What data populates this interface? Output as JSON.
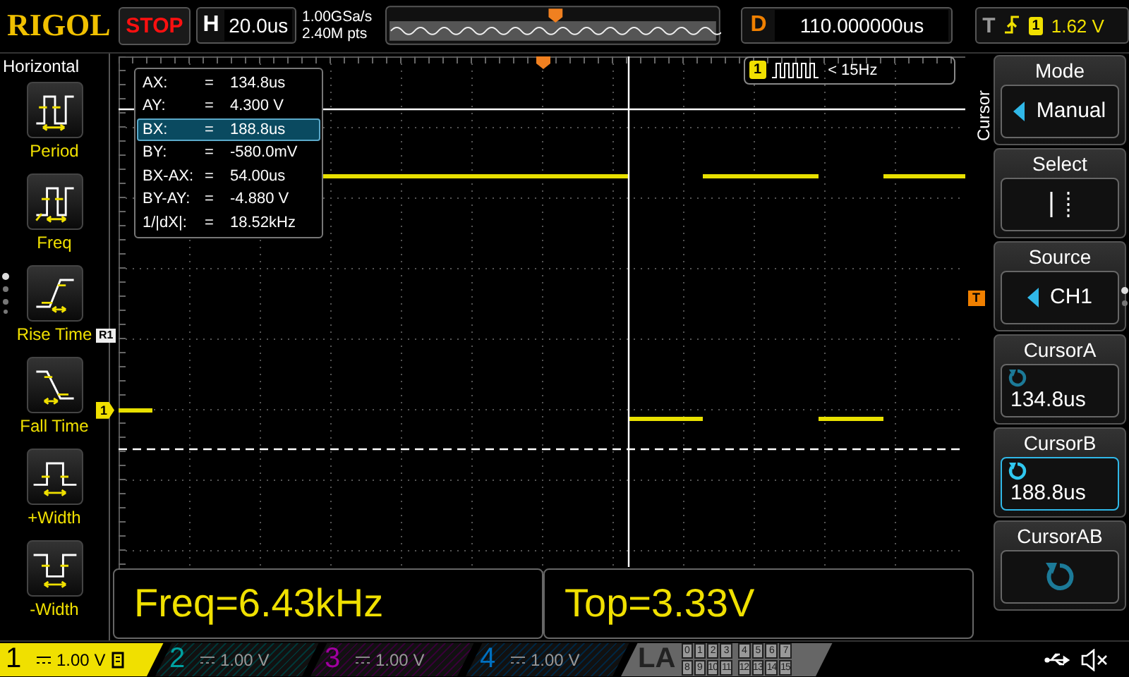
{
  "top_bar": {
    "logo": "RIGOL",
    "run_state": "STOP",
    "horizontal": {
      "label": "H",
      "value": "20.0us"
    },
    "sample_rate": "1.00GSa/s",
    "memory_depth": "2.40M pts",
    "delay": {
      "label": "D",
      "value": "110.000000us"
    },
    "trigger": {
      "label": "T",
      "channel": "1",
      "level": "1.62 V"
    }
  },
  "left_menu": {
    "title": "Horizontal",
    "items": [
      {
        "kind": "period",
        "label": "Period"
      },
      {
        "kind": "freq",
        "label": "Freq"
      },
      {
        "kind": "rise",
        "label": "Rise Time"
      },
      {
        "kind": "fall",
        "label": "Fall Time"
      },
      {
        "kind": "pwidth",
        "label": "+Width"
      },
      {
        "kind": "nwidth",
        "label": "-Width"
      }
    ]
  },
  "screen": {
    "reference_marker": "R1",
    "channel_marker": "1",
    "trigger_level_marker": "T",
    "cursor_readout": [
      {
        "label": "AX:",
        "sign": "=",
        "value": "134.8us",
        "selected": false
      },
      {
        "label": "AY:",
        "sign": "=",
        "value": "4.300 V",
        "selected": false
      },
      {
        "label": "BX:",
        "sign": "=",
        "value": "188.8us",
        "selected": true
      },
      {
        "label": "BY:",
        "sign": "=",
        "value": "-580.0mV",
        "selected": false
      },
      {
        "label": "BX-AX:",
        "sign": "=",
        "value": "54.00us",
        "selected": false
      },
      {
        "label": "BY-AY:",
        "sign": "=",
        "value": "-4.880 V",
        "selected": false
      },
      {
        "label": "1/|dX|:",
        "sign": "=",
        "value": "18.52kHz",
        "selected": false
      }
    ],
    "trigger_counter": {
      "channel": "1",
      "value": "< 15Hz"
    },
    "measurements": [
      {
        "text": "Freq=6.43kHz"
      },
      {
        "text": "Top=3.33V"
      }
    ]
  },
  "side_menu": {
    "title": "Cursor",
    "items": [
      {
        "kind": "select",
        "label": "Mode",
        "value": "Manual",
        "selected": false
      },
      {
        "kind": "cursor-pair",
        "label": "Select",
        "selected": false
      },
      {
        "kind": "select",
        "label": "Source",
        "value": "CH1",
        "selected": false
      },
      {
        "kind": "knob",
        "label": "CursorA",
        "value": "134.8us",
        "selected": false
      },
      {
        "kind": "knob",
        "label": "CursorB",
        "value": "188.8us",
        "selected": true
      },
      {
        "kind": "knob",
        "label": "CursorAB",
        "selected": false
      }
    ]
  },
  "channels": [
    {
      "number": "1",
      "scale": "1.00 V",
      "on": true,
      "color": "#f0e000"
    },
    {
      "number": "2",
      "scale": "1.00 V",
      "on": false,
      "color": "#00a0a0"
    },
    {
      "number": "3",
      "scale": "1.00 V",
      "on": false,
      "color": "#a000a0"
    },
    {
      "number": "4",
      "scale": "1.00 V",
      "on": false,
      "color": "#0070c0"
    }
  ],
  "logic_analyzer": {
    "label": "LA",
    "bits": [
      "0",
      "1",
      "2",
      "3",
      "4",
      "5",
      "6",
      "7",
      "8",
      "9",
      "10",
      "11",
      "12",
      "13",
      "14",
      "15"
    ]
  }
}
